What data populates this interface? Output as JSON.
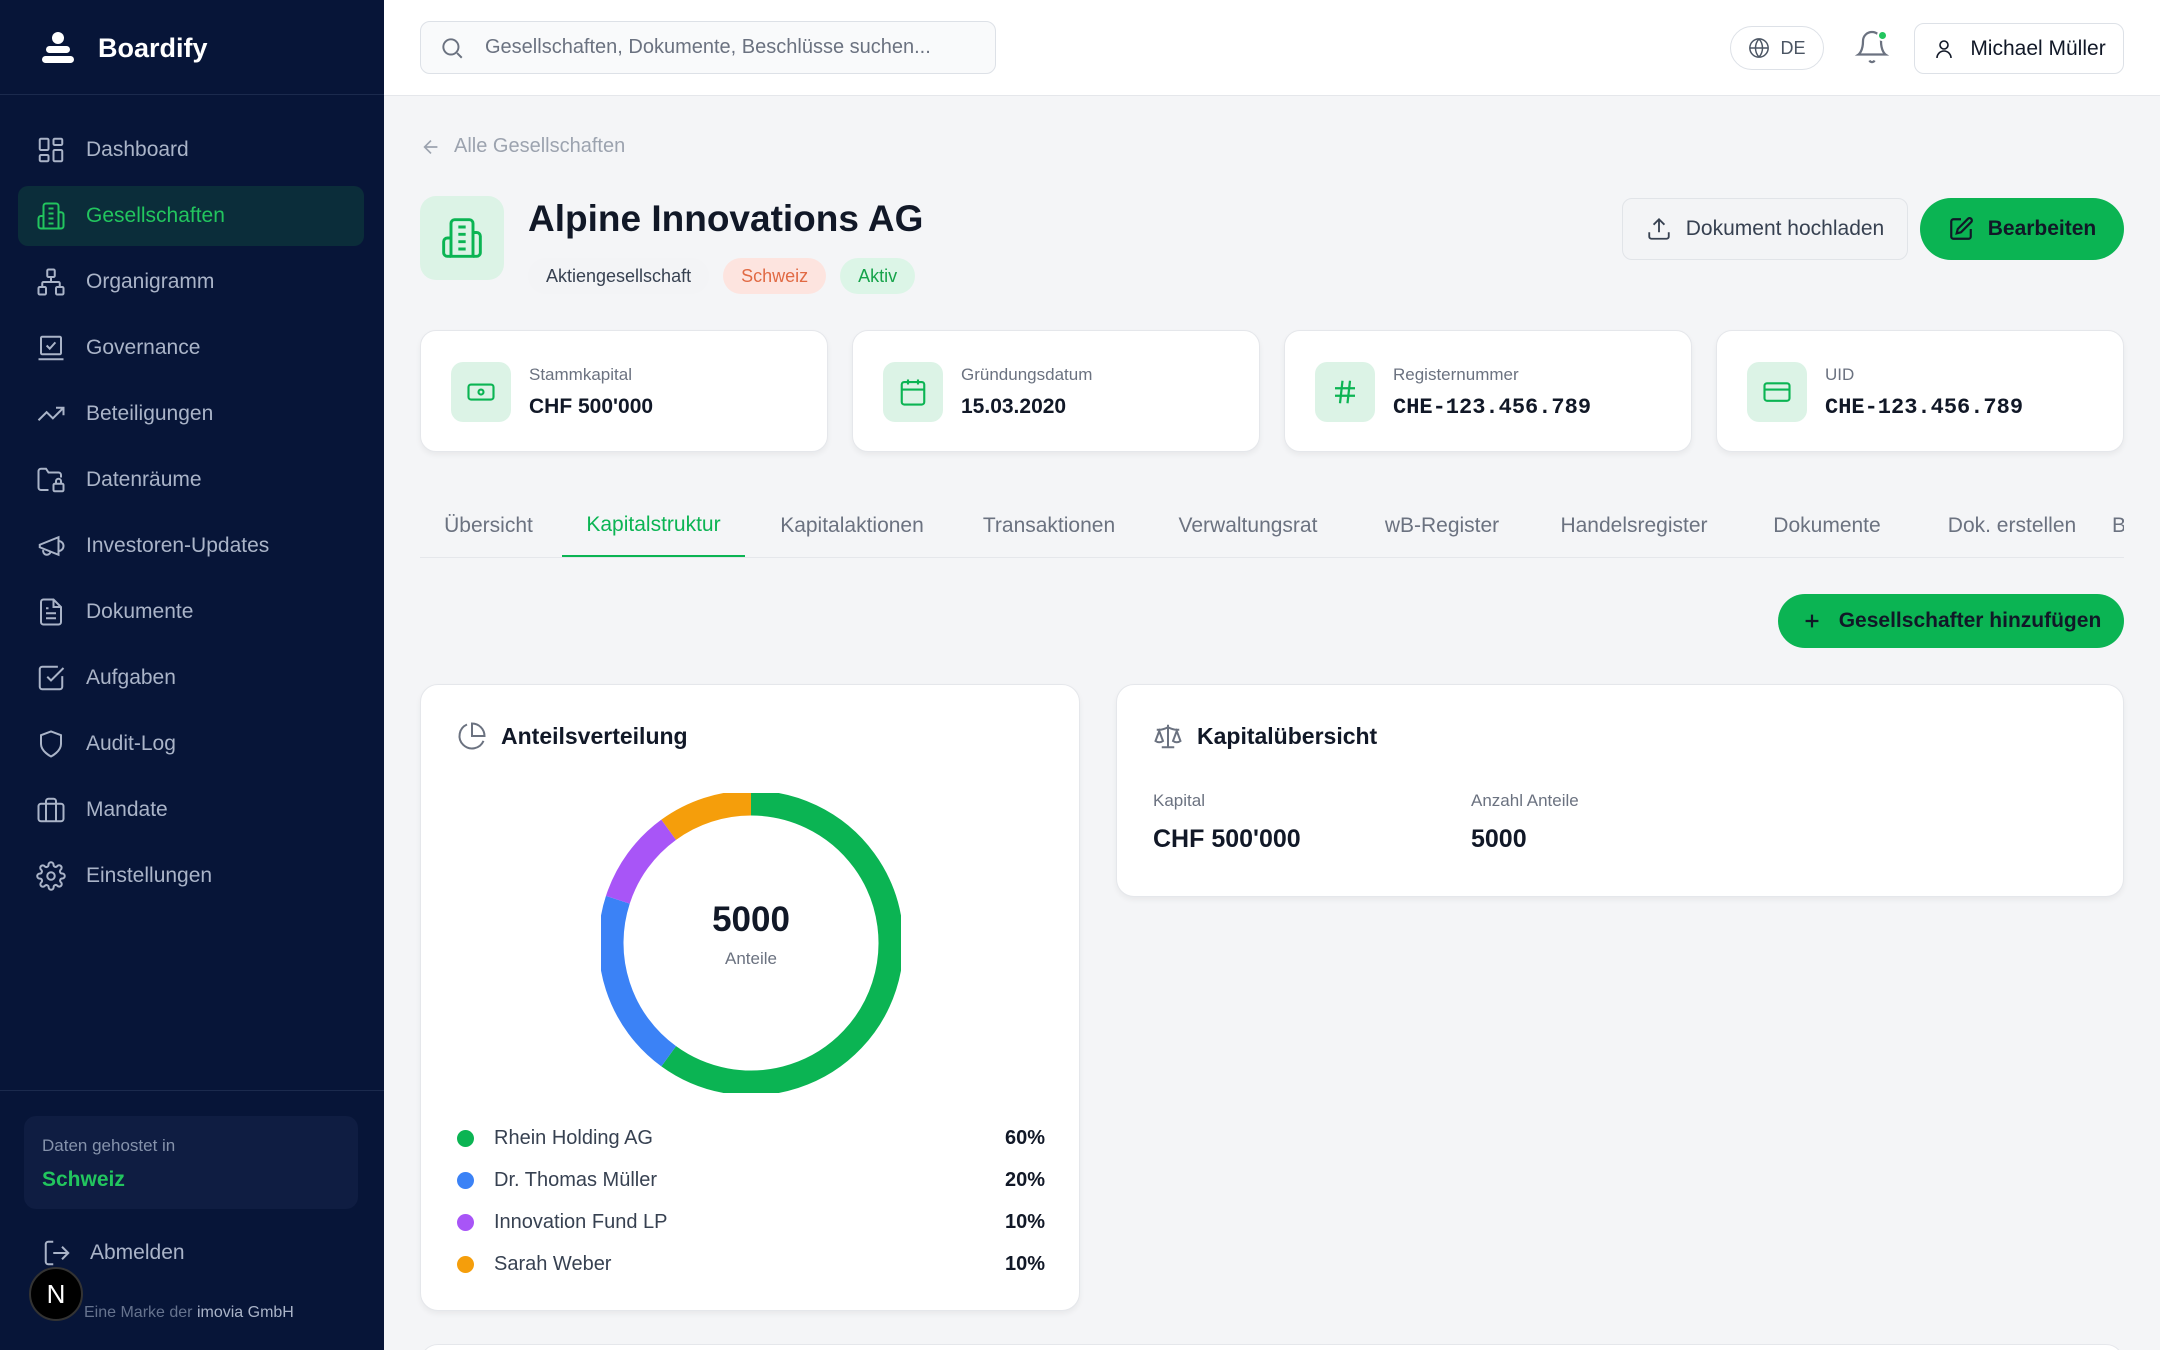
{
  "app": {
    "name": "Boardify"
  },
  "sidebar": {
    "items": [
      {
        "label": "Dashboard",
        "icon": "dashboard-icon",
        "active": false
      },
      {
        "label": "Gesellschaften",
        "icon": "building-icon",
        "active": true
      },
      {
        "label": "Organigramm",
        "icon": "org-chart-icon",
        "active": false
      },
      {
        "label": "Governance",
        "icon": "governance-icon",
        "active": false
      },
      {
        "label": "Beteiligungen",
        "icon": "trending-up-icon",
        "active": false
      },
      {
        "label": "Datenräume",
        "icon": "folder-lock-icon",
        "active": false
      },
      {
        "label": "Investoren-Updates",
        "icon": "megaphone-icon",
        "active": false
      },
      {
        "label": "Dokumente",
        "icon": "document-icon",
        "active": false
      },
      {
        "label": "Aufgaben",
        "icon": "checkbox-icon",
        "active": false
      },
      {
        "label": "Audit-Log",
        "icon": "shield-icon",
        "active": false
      },
      {
        "label": "Mandate",
        "icon": "briefcase-icon",
        "active": false
      },
      {
        "label": "Einstellungen",
        "icon": "gear-icon",
        "active": false
      }
    ],
    "hosted_label": "Daten gehostet in",
    "hosted_value": "Schweiz",
    "logout": "Abmelden",
    "brand_prefix": "Eine Marke der",
    "brand_name": "imovia GmbH",
    "n_badge": "N"
  },
  "topbar": {
    "search_placeholder": "Gesellschaften, Dokumente, Beschlüsse suchen...",
    "lang": "DE",
    "user": "Michael Müller"
  },
  "breadcrumb": {
    "back": "Alle Gesellschaften"
  },
  "company": {
    "name": "Alpine Innovations AG",
    "badges": [
      "Aktiengesellschaft",
      "Schweiz",
      "Aktiv"
    ]
  },
  "actions": {
    "upload": "Dokument hochladen",
    "edit": "Bearbeiten",
    "add_shareholder": "Gesellschafter hinzufügen"
  },
  "stats": [
    {
      "label": "Stammkapital",
      "value": "CHF 500'000",
      "icon": "banknote-icon"
    },
    {
      "label": "Gründungsdatum",
      "value": "15.03.2020",
      "icon": "calendar-icon"
    },
    {
      "label": "Registernummer",
      "value": "CHE-123.456.789",
      "icon": "hash-icon"
    },
    {
      "label": "UID",
      "value": "CHE-123.456.789",
      "icon": "credit-card-icon"
    }
  ],
  "tabs": [
    "Übersicht",
    "Kapitalstruktur",
    "Kapitalaktionen",
    "Transaktionen",
    "Verwaltungsrat",
    "wB-Register",
    "Handelsregister",
    "Dokumente",
    "Dok. erstellen",
    "Besch"
  ],
  "active_tab": "Kapitalstruktur",
  "distribution": {
    "title": "Anteilsverteilung",
    "total": "5000",
    "total_label": "Anteile",
    "shareholders": [
      {
        "name": "Rhein Holding AG",
        "pct": "60%",
        "share": 60,
        "color": "#0bb453"
      },
      {
        "name": "Dr. Thomas Müller",
        "pct": "20%",
        "share": 20,
        "color": "#3b82f6"
      },
      {
        "name": "Innovation Fund LP",
        "pct": "10%",
        "share": 10,
        "color": "#a855f7"
      },
      {
        "name": "Sarah Weber",
        "pct": "10%",
        "share": 10,
        "color": "#f59e0b"
      }
    ]
  },
  "capital": {
    "title": "Kapitalübersicht",
    "kapital_label": "Kapital",
    "kapital_value": "CHF 500'000",
    "anteile_label": "Anzahl Anteile",
    "anteile_value": "5000"
  }
}
